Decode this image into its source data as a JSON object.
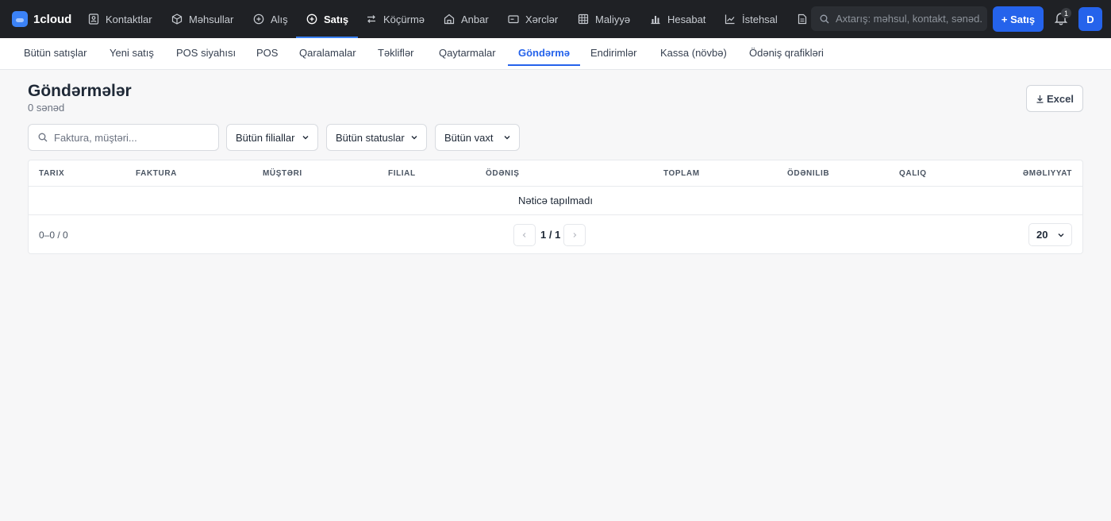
{
  "app": {
    "name": "1cloud",
    "brand_color": "#3b82f6",
    "accent_color": "#2563eb"
  },
  "topnav": {
    "items": [
      {
        "label": "Kontaktlar",
        "icon": "contacts-icon"
      },
      {
        "label": "Məhsullar",
        "icon": "box-icon"
      },
      {
        "label": "Alış",
        "icon": "plus-circle-icon"
      },
      {
        "label": "Satış",
        "icon": "plus-circle-icon",
        "active": true
      },
      {
        "label": "Köçürmə",
        "icon": "transfer-icon"
      },
      {
        "label": "Anbar",
        "icon": "warehouse-icon"
      },
      {
        "label": "Xərclər",
        "icon": "card-icon"
      },
      {
        "label": "Maliyyə",
        "icon": "grid-icon"
      },
      {
        "label": "Hesabat",
        "icon": "bar-chart-icon"
      },
      {
        "label": "İstehsal",
        "icon": "line-chart-icon"
      }
    ],
    "search_placeholder": "Axtarış: məhsul, kontakt, sənəd...",
    "new_sale_label": "+ Satış",
    "notification_count": "1",
    "avatar_initial": "D"
  },
  "subnav": {
    "items": [
      {
        "label": "Bütün satışlar"
      },
      {
        "label": "Yeni satış"
      },
      {
        "label": "POS siyahısı"
      },
      {
        "label": "POS"
      },
      {
        "label": "Qaralamalar"
      },
      {
        "label": "Təkliflər"
      },
      {
        "label": "Qaytarmalar"
      },
      {
        "label": "Göndərmə",
        "active": true
      },
      {
        "label": "Endirimlər"
      },
      {
        "label": "Kassa (növbə)"
      },
      {
        "label": "Ödəniş qrafikləri"
      }
    ]
  },
  "page": {
    "title": "Göndərmələr",
    "subtitle": "0 sənəd",
    "excel_label": "Excel"
  },
  "filters": {
    "search_placeholder": "Faktura, müştəri...",
    "branch": "Bütün filiallar",
    "status": "Bütün statuslar",
    "time": "Bütün vaxt"
  },
  "table": {
    "columns": [
      "Tarix",
      "Faktura",
      "Müştəri",
      "Filial",
      "Ödəniş",
      "Toplam",
      "Ödənilib",
      "Qalıq",
      "Əməliyyat"
    ],
    "empty_text": "Nəticə tapılmadı",
    "range_text": "0–0 / 0",
    "page_text": "1 / 1",
    "per_page": "20"
  }
}
